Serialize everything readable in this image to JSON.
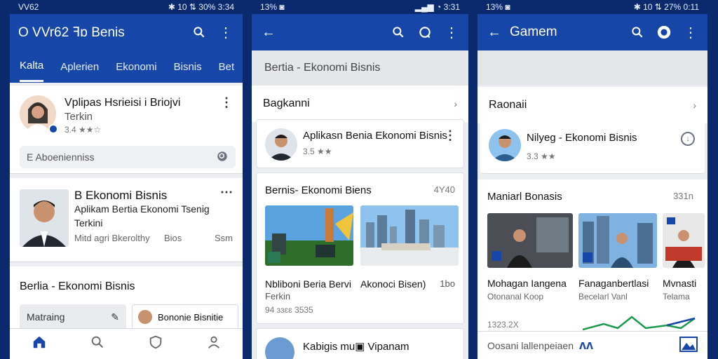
{
  "phone1": {
    "status_left": "VV62",
    "status_right": "✱ 10 ⇅ 30%",
    "status_time": "3:34",
    "app_title": "O VVr62 ꟻɒ Benis",
    "tabs": [
      "Kalta",
      "Aplerien",
      "Ekonomi",
      "Bisnis",
      "Bet"
    ],
    "card1": {
      "title": "Vplipas Hsrieisi i Briojvi",
      "subtitle": "Terkin",
      "rating": "3.4 ★★☆"
    },
    "search_placeholder": "E Aboenienniss",
    "card2": {
      "title": "B Ekonomi Bisnis",
      "subtitle": "Aplikam Bertia Ekonomi Tsenig",
      "subtitle2": "Terkini",
      "meta": "Mitd agri Bkerolthy",
      "meta2": "Bios",
      "meta_right": "Ssm"
    },
    "section_title": "Berlia - Ekonomi Bisnis",
    "chip1": "Matraing",
    "chip2": "Bononie Bisnitie"
  },
  "phone2": {
    "status_left": "13% ◙",
    "status_right": "▂▄▆ ◔",
    "status_time": "3:31",
    "search_text": "Bertia - Ekonomi Bisnis",
    "section1": "Bagkanni",
    "card1": {
      "title": "Aplikasn Benia Ekonomi Bisnis",
      "rating": "3.5 ★★"
    },
    "section2": "Bernis- Ekonomi Biens",
    "section2_right": "4Y40",
    "tile1": {
      "title": "Nbliboni Beria Bervi",
      "sub": "Ferkin"
    },
    "tile2": {
      "title": "Akonoci Bisen)",
      "sub": "1bo"
    },
    "meta": "94 ɜɜɛɛ 3535",
    "card2": {
      "title": "Kabigis mu▣ Vipanam"
    }
  },
  "phone3": {
    "status_left": "13% ◙",
    "status_right": "✱ 10 ⇅ 27%",
    "status_time": "0:11",
    "app_title": "Gamem",
    "section1": "Raonaii",
    "card1": {
      "title": "Nilyeg - Ekonomi Bisnis",
      "rating": "3.3 ★★"
    },
    "section2": "Maniarl Bonasis",
    "section2_right": "331n",
    "tiles": [
      {
        "title": "Mohagan Iangena",
        "sub": "Otonanal Koop"
      },
      {
        "title": "Fanaganbertlasi",
        "sub": "Becelarl Vanl"
      },
      {
        "title": "Mvnasti",
        "sub": "Telama"
      }
    ],
    "chart_value": "1323.2X",
    "footer_text": "Oosani lallenpeiaen",
    "colors": {
      "chart_line": "#1a9a4b",
      "chart_line2": "#1647a8"
    }
  },
  "colors": {
    "primary": "#1647a8",
    "dark": "#0b2a6e",
    "bg": "#eceef1"
  }
}
